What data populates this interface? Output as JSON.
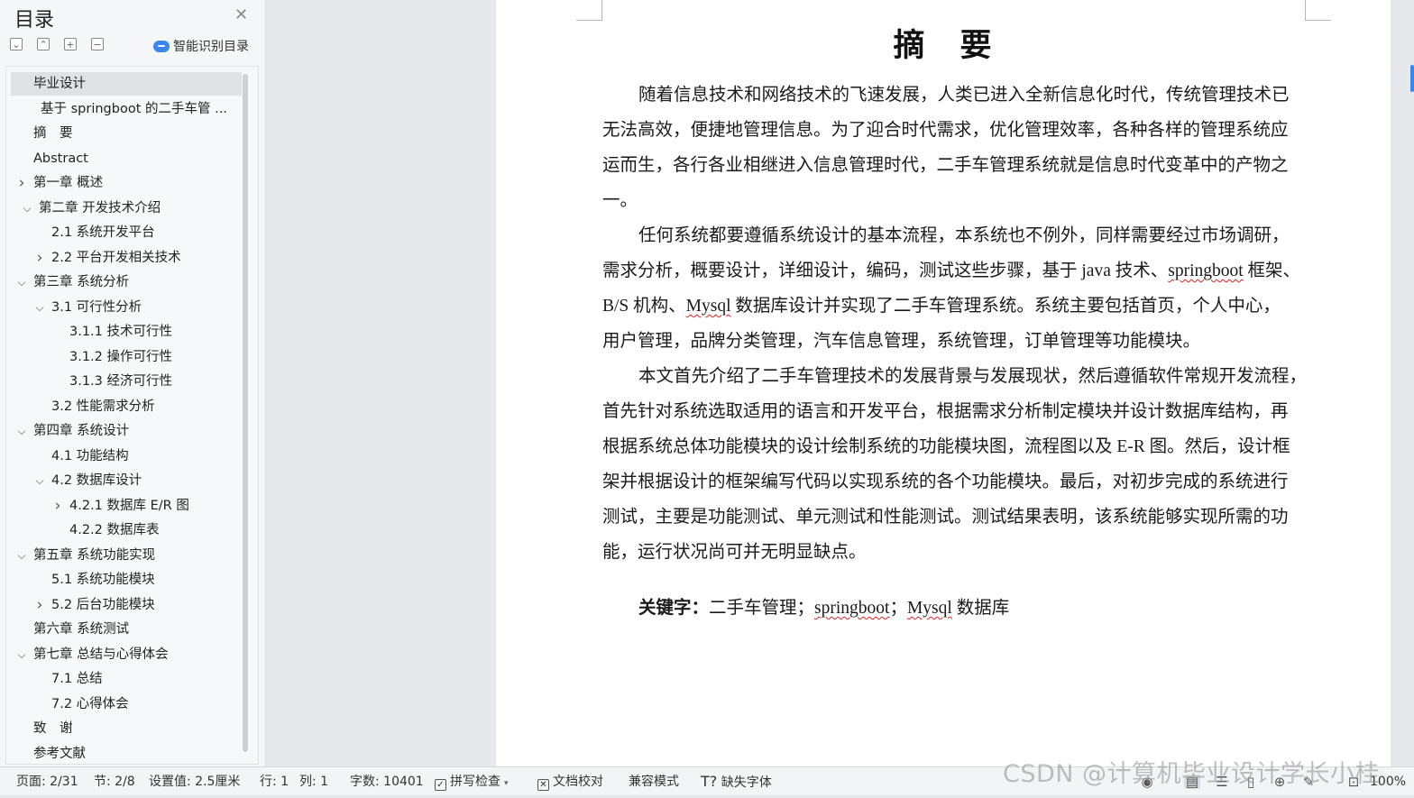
{
  "toc": {
    "title": "目录",
    "smart_label": "智能识别目录",
    "items": [
      {
        "label": "毕业设计",
        "level": 0,
        "expander": "none",
        "selected": true
      },
      {
        "label": "基于 springboot 的二手车管 ...",
        "level": 0.4,
        "expander": "none"
      },
      {
        "label": "摘　要",
        "level": 0,
        "expander": "none"
      },
      {
        "label": "Abstract",
        "level": 0,
        "expander": "none"
      },
      {
        "label": "第一章  概述",
        "level": 0,
        "expander": "collapsed"
      },
      {
        "label": "第二章  开发技术介绍",
        "level": 0.3,
        "expander": "expanded"
      },
      {
        "label": "2.1  系统开发平台",
        "level": 1,
        "expander": "none"
      },
      {
        "label": "2.2  平台开发相关技术",
        "level": 1,
        "expander": "collapsed"
      },
      {
        "label": "第三章  系统分析",
        "level": 0,
        "expander": "expanded"
      },
      {
        "label": "3.1  可行性分析",
        "level": 1,
        "expander": "expanded"
      },
      {
        "label": "3.1.1 技术可行性",
        "level": 2,
        "expander": "none"
      },
      {
        "label": "3.1.2 操作可行性",
        "level": 2,
        "expander": "none"
      },
      {
        "label": "3.1.3 经济可行性",
        "level": 2,
        "expander": "none"
      },
      {
        "label": "3.2 性能需求分析",
        "level": 1,
        "expander": "none"
      },
      {
        "label": "第四章  系统设计",
        "level": 0,
        "expander": "expanded"
      },
      {
        "label": "4.1 功能结构",
        "level": 1,
        "expander": "none"
      },
      {
        "label": "4.2  数据库设计",
        "level": 1,
        "expander": "expanded"
      },
      {
        "label": "4.2.1  数据库 E/R 图",
        "level": 2,
        "expander": "collapsed"
      },
      {
        "label": "4.2.2  数据库表",
        "level": 2,
        "expander": "none"
      },
      {
        "label": "第五章  系统功能实现",
        "level": 0,
        "expander": "expanded"
      },
      {
        "label": "5.1 系统功能模块",
        "level": 1,
        "expander": "none"
      },
      {
        "label": "5.2 后台功能模块",
        "level": 1,
        "expander": "collapsed"
      },
      {
        "label": "第六章  系统测试",
        "level": 0,
        "expander": "none"
      },
      {
        "label": "第七章  总结与心得体会",
        "level": 0,
        "expander": "expanded"
      },
      {
        "label": "7.1 总结",
        "level": 1,
        "expander": "none"
      },
      {
        "label": "7.2 心得体会",
        "level": 1,
        "expander": "none"
      },
      {
        "label": "致　谢",
        "level": 0,
        "expander": "none"
      },
      {
        "label": "参考文献",
        "level": 0,
        "expander": "none"
      }
    ]
  },
  "document": {
    "heading": "摘　要",
    "lines": [
      {
        "indent": true,
        "segments": [
          {
            "t": "随着信息技术和网络技术的飞速发展，人类已进入全新信息化时代，传统管理技术已"
          }
        ]
      },
      {
        "segments": [
          {
            "t": "无法高效，便捷地管理信息。为了迎合时代需求，优化管理效率，各种各样的管理系统应"
          }
        ]
      },
      {
        "segments": [
          {
            "t": "运而生，各行各业相继进入信息管理时代，二手车管理系统就是信息时代变革中的产物之"
          }
        ]
      },
      {
        "segments": [
          {
            "t": "一。"
          }
        ]
      },
      {
        "indent": true,
        "segments": [
          {
            "t": "任何系统都要遵循系统设计的基本流程，本系统也不例外，同样需要经过市场调研，"
          }
        ]
      },
      {
        "segments": [
          {
            "t": "需求分析，概要设计，详细设计，编码，测试这些步骤，基于 java 技术、"
          },
          {
            "t": "springboot",
            "sp": true
          },
          {
            "t": " 框架、"
          }
        ]
      },
      {
        "segments": [
          {
            "t": "B/S 机构、"
          },
          {
            "t": "Mysql",
            "sp": true
          },
          {
            "t": " 数据库设计并实现了二手车管理系统。系统主要包括首页，个人中心，"
          }
        ]
      },
      {
        "segments": [
          {
            "t": "用户管理，品牌分类管理，汽车信息管理，系统管理，订单管理等功能模块。"
          }
        ]
      },
      {
        "indent": true,
        "segments": [
          {
            "t": "本文首先介绍了二手车管理技术的发展背景与发展现状，然后遵循软件常规开发流程，"
          }
        ]
      },
      {
        "segments": [
          {
            "t": "首先针对系统选取适用的语言和开发平台，根据需求分析制定模块并设计数据库结构，再"
          }
        ]
      },
      {
        "segments": [
          {
            "t": "根据系统总体功能模块的设计绘制系统的功能模块图，流程图以及 E-R 图。然后，设计框"
          }
        ]
      },
      {
        "segments": [
          {
            "t": "架并根据设计的框架编写代码以实现系统的各个功能模块。最后，对初步完成的系统进行"
          }
        ]
      },
      {
        "segments": [
          {
            "t": "测试，主要是功能测试、单元测试和性能测试。测试结果表明，该系统能够实现所需的功"
          }
        ]
      },
      {
        "segments": [
          {
            "t": "能，运行状况尚可并无明显缺点。"
          }
        ]
      }
    ],
    "keywords": {
      "label": "关键字：",
      "segments": [
        {
          "t": "二手车管理；"
        },
        {
          "t": "springboot",
          "sp": true
        },
        {
          "t": "；"
        },
        {
          "t": "Mysql",
          "sp": true
        },
        {
          "t": " 数据库"
        }
      ]
    }
  },
  "status": {
    "page": "页面: 2/31",
    "section": "节: 2/8",
    "setting": "设置值: 2.5厘米",
    "row": "行: 1",
    "col": "列: 1",
    "words": "字数: 10401",
    "spell": "拼写检查",
    "proof": "文档校对",
    "compat": "兼容模式",
    "missing_font": "缺失字体",
    "zoom": "100%"
  },
  "watermark": "CSDN @计算机毕业设计学长小桂"
}
